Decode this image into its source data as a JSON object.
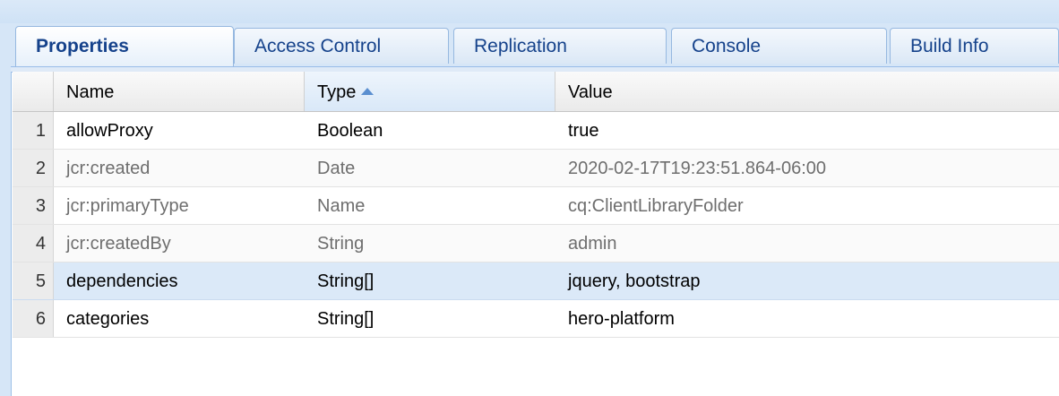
{
  "tabs": [
    {
      "label": "Properties",
      "active": true
    },
    {
      "label": "Access Control",
      "active": false
    },
    {
      "label": "Replication",
      "active": false
    },
    {
      "label": "Console",
      "active": false
    },
    {
      "label": "Build Info",
      "active": false
    }
  ],
  "grid": {
    "columns": [
      {
        "label": "Name"
      },
      {
        "label": "Type",
        "sort": "ascending"
      },
      {
        "label": "Value"
      }
    ],
    "rows": [
      {
        "num": "1",
        "name": "allowProxy",
        "type": "Boolean",
        "value": "true"
      },
      {
        "num": "2",
        "name": "jcr:created",
        "type": "Date",
        "value": "2020-02-17T19:23:51.864-06:00"
      },
      {
        "num": "3",
        "name": "jcr:primaryType",
        "type": "Name",
        "value": "cq:ClientLibraryFolder"
      },
      {
        "num": "4",
        "name": "jcr:createdBy",
        "type": "String",
        "value": "admin"
      },
      {
        "num": "5",
        "name": "dependencies",
        "type": "String[]",
        "value": "jquery, bootstrap",
        "selected": true
      },
      {
        "num": "6",
        "name": "categories",
        "type": "String[]",
        "value": "hero-platform"
      }
    ]
  },
  "colors": {
    "tab_text": "#15428b",
    "selected_row": "#dbe9f8",
    "frame": "#d6e6f7"
  }
}
